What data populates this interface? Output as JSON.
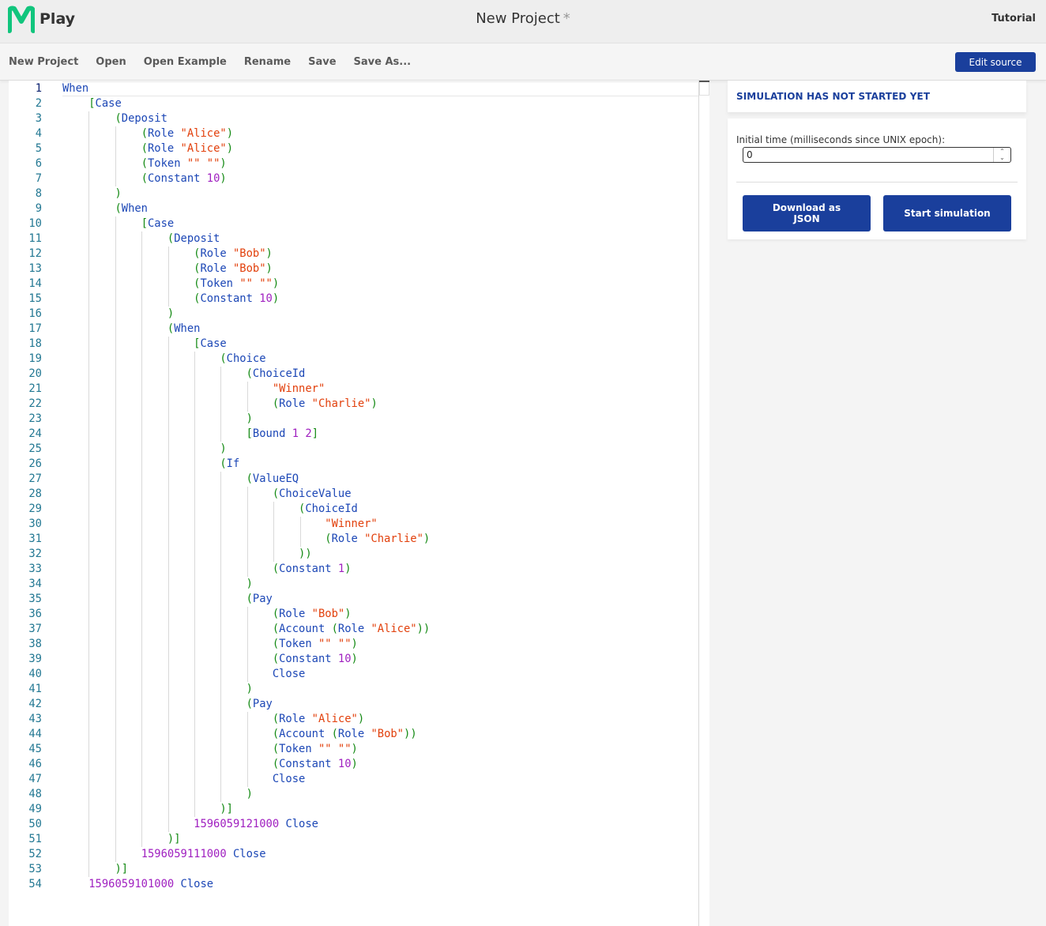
{
  "header": {
    "logo_text": "Play",
    "title": "New Project",
    "unsaved_marker": "*",
    "tutorial_label": "Tutorial"
  },
  "toolbar": {
    "items": [
      "New Project",
      "Open",
      "Open Example",
      "Rename",
      "Save",
      "Save As..."
    ],
    "edit_source_label": "Edit source"
  },
  "simulation": {
    "status": "SIMULATION HAS NOT STARTED YET",
    "initial_time_label": "Initial time (milliseconds since UNIX epoch):",
    "initial_time_value": "0",
    "download_label": "Download as JSON",
    "start_label": "Start simulation"
  },
  "editor": {
    "active_line": 1,
    "lines": [
      "When",
      "    [Case",
      "        (Deposit",
      "            (Role \"Alice\")",
      "            (Role \"Alice\")",
      "            (Token \"\" \"\")",
      "            (Constant 10)",
      "        )",
      "        (When",
      "            [Case",
      "                (Deposit",
      "                    (Role \"Bob\")",
      "                    (Role \"Bob\")",
      "                    (Token \"\" \"\")",
      "                    (Constant 10)",
      "                )",
      "                (When",
      "                    [Case",
      "                        (Choice",
      "                            (ChoiceId",
      "                                \"Winner\"",
      "                                (Role \"Charlie\")",
      "                            )",
      "                            [Bound 1 2]",
      "                        )",
      "                        (If",
      "                            (ValueEQ",
      "                                (ChoiceValue",
      "                                    (ChoiceId",
      "                                        \"Winner\"",
      "                                        (Role \"Charlie\")",
      "                                    ))",
      "                                (Constant 1)",
      "                            )",
      "                            (Pay",
      "                                (Role \"Bob\")",
      "                                (Account (Role \"Alice\"))",
      "                                (Token \"\" \"\")",
      "                                (Constant 10)",
      "                                Close",
      "                            )",
      "                            (Pay",
      "                                (Role \"Alice\")",
      "                                (Account (Role \"Bob\"))",
      "                                (Token \"\" \"\")",
      "                                (Constant 10)",
      "                                Close",
      "                            )",
      "                        )]",
      "                    1596059121000 Close",
      "                )]",
      "            1596059111000 Close",
      "        )]",
      "    1596059101000 Close"
    ]
  }
}
